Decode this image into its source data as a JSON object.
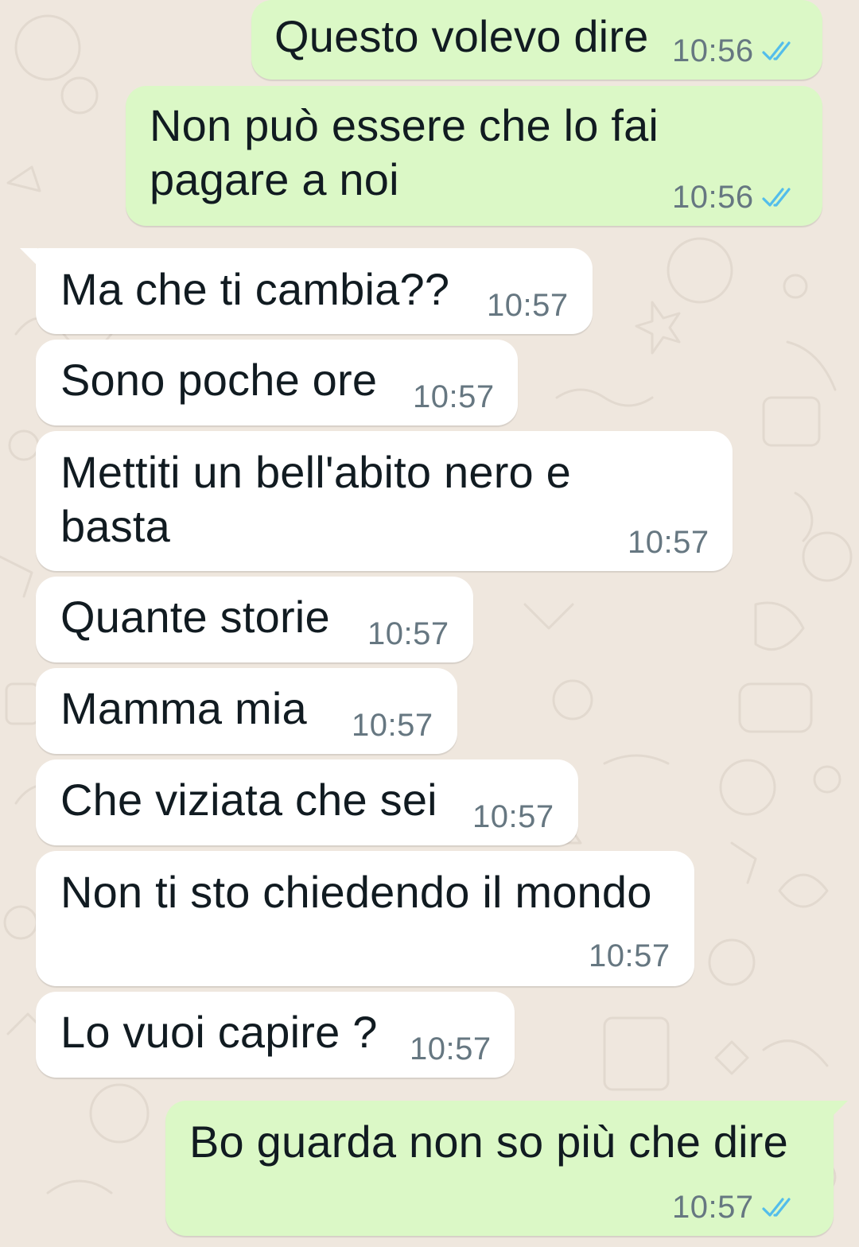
{
  "colors": {
    "chat_background": "#efe7de",
    "outgoing_bubble": "#dbf8c6",
    "incoming_bubble": "#ffffff",
    "message_text": "#111b21",
    "timestamp_text": "#667781",
    "read_ticks": "#53bdeb"
  },
  "icons": {
    "read_status": "double-check-icon"
  },
  "messages": [
    {
      "direction": "outgoing",
      "text": "Questo volevo dire",
      "time": "10:56",
      "status": "read"
    },
    {
      "direction": "outgoing",
      "text": "Non può essere che lo fai\npagare a noi",
      "time": "10:56",
      "status": "read"
    },
    {
      "direction": "incoming",
      "text": "Ma che ti cambia??",
      "time": "10:57"
    },
    {
      "direction": "incoming",
      "text": "Sono poche ore",
      "time": "10:57"
    },
    {
      "direction": "incoming",
      "text": "Mettiti un bell'abito nero e\nbasta",
      "time": "10:57"
    },
    {
      "direction": "incoming",
      "text": "Quante storie",
      "time": "10:57"
    },
    {
      "direction": "incoming",
      "text": "Mamma mia",
      "time": "10:57"
    },
    {
      "direction": "incoming",
      "text": "Che viziata che sei",
      "time": "10:57"
    },
    {
      "direction": "incoming",
      "text": "Non ti sto chiedendo il mondo",
      "time": "10:57"
    },
    {
      "direction": "incoming",
      "text": "Lo vuoi capire ?",
      "time": "10:57"
    },
    {
      "direction": "outgoing",
      "text": "Bo guarda non so più che dire",
      "time": "10:57",
      "status": "read"
    }
  ]
}
